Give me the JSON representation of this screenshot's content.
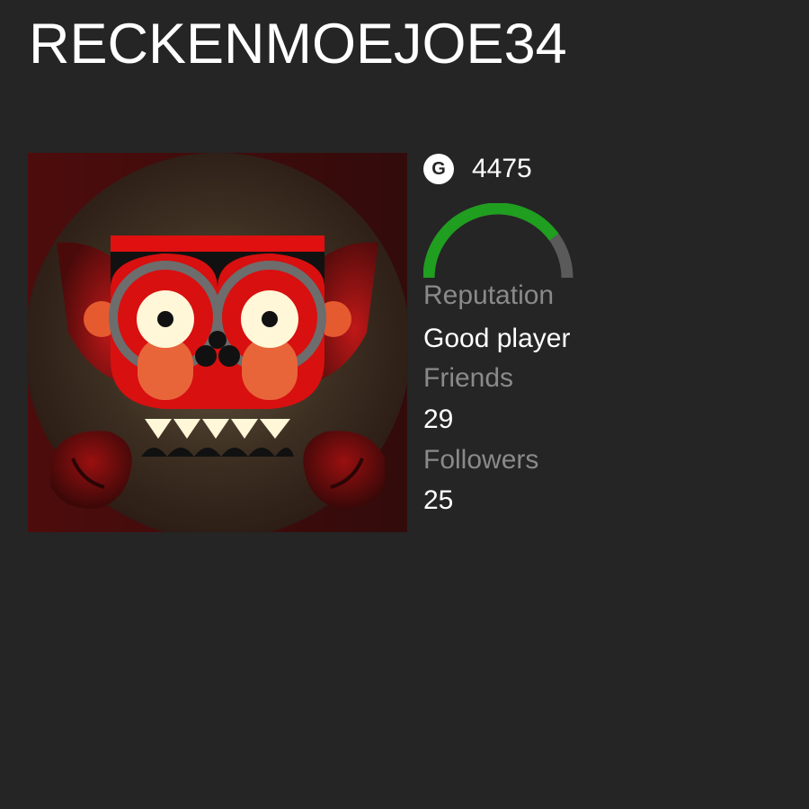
{
  "profile": {
    "gamertag": "RECKENMOEJOE34",
    "gamerscore_icon": "G",
    "gamerscore": "4475"
  },
  "reputation": {
    "label": "Reputation",
    "value": "Good player",
    "meter_fraction": 0.8,
    "meter_color": "#1f9e1f",
    "track_color": "#5a5a5a"
  },
  "friends": {
    "label": "Friends",
    "value": "29"
  },
  "followers": {
    "label": "Followers",
    "value": "25"
  },
  "avatar": {
    "icon": "red-monster-avatar"
  }
}
